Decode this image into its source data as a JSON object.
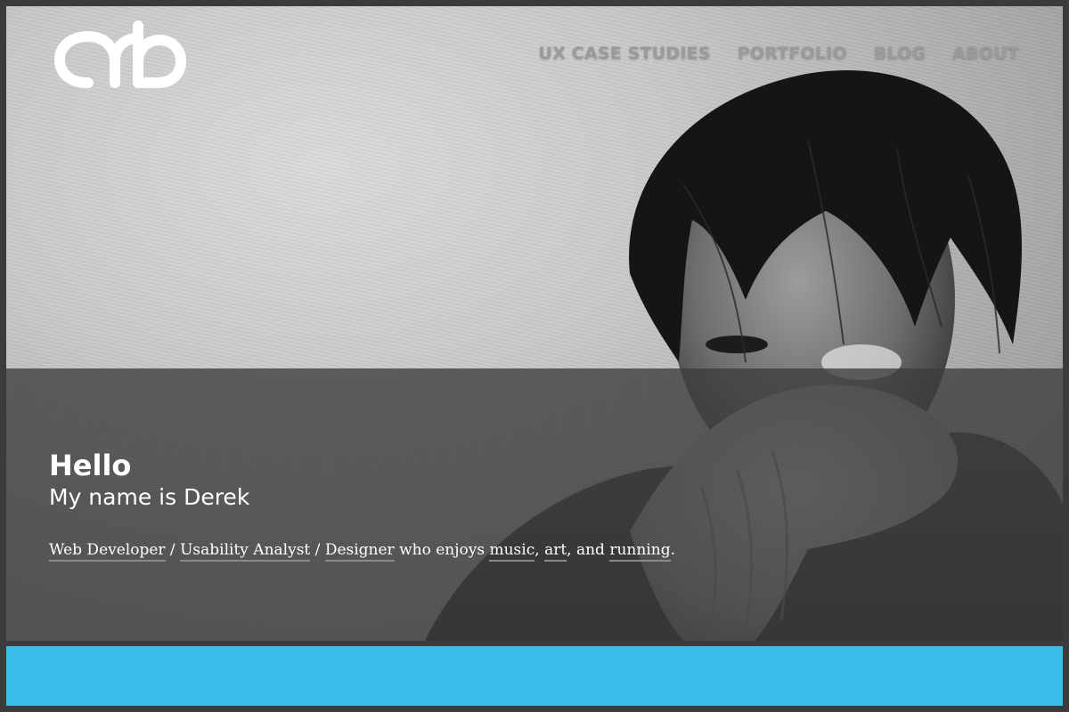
{
  "nav": {
    "items": [
      {
        "label": "UX CASE STUDIES"
      },
      {
        "label": "PORTFOLIO"
      },
      {
        "label": "BLOG"
      },
      {
        "label": "ABOUT"
      }
    ]
  },
  "intro": {
    "heading": "Hello",
    "subheading": "My name is Derek",
    "tagline": {
      "link_web_developer": "Web Developer",
      "sep1": " / ",
      "link_usability": "Usability Analyst",
      "sep2": " / ",
      "link_designer": "Designer",
      "text_enjoys": " who enjoys ",
      "link_music": "music",
      "sep3": ", ",
      "link_art": "art",
      "text_and": ", and ",
      "link_running": "running",
      "end": "."
    }
  },
  "colors": {
    "accent_blue": "#3bbbea",
    "nav_text": "#9a9a9a",
    "frame": "#3b3b3b"
  },
  "icons": {
    "logo": "drb-logo-icon"
  }
}
